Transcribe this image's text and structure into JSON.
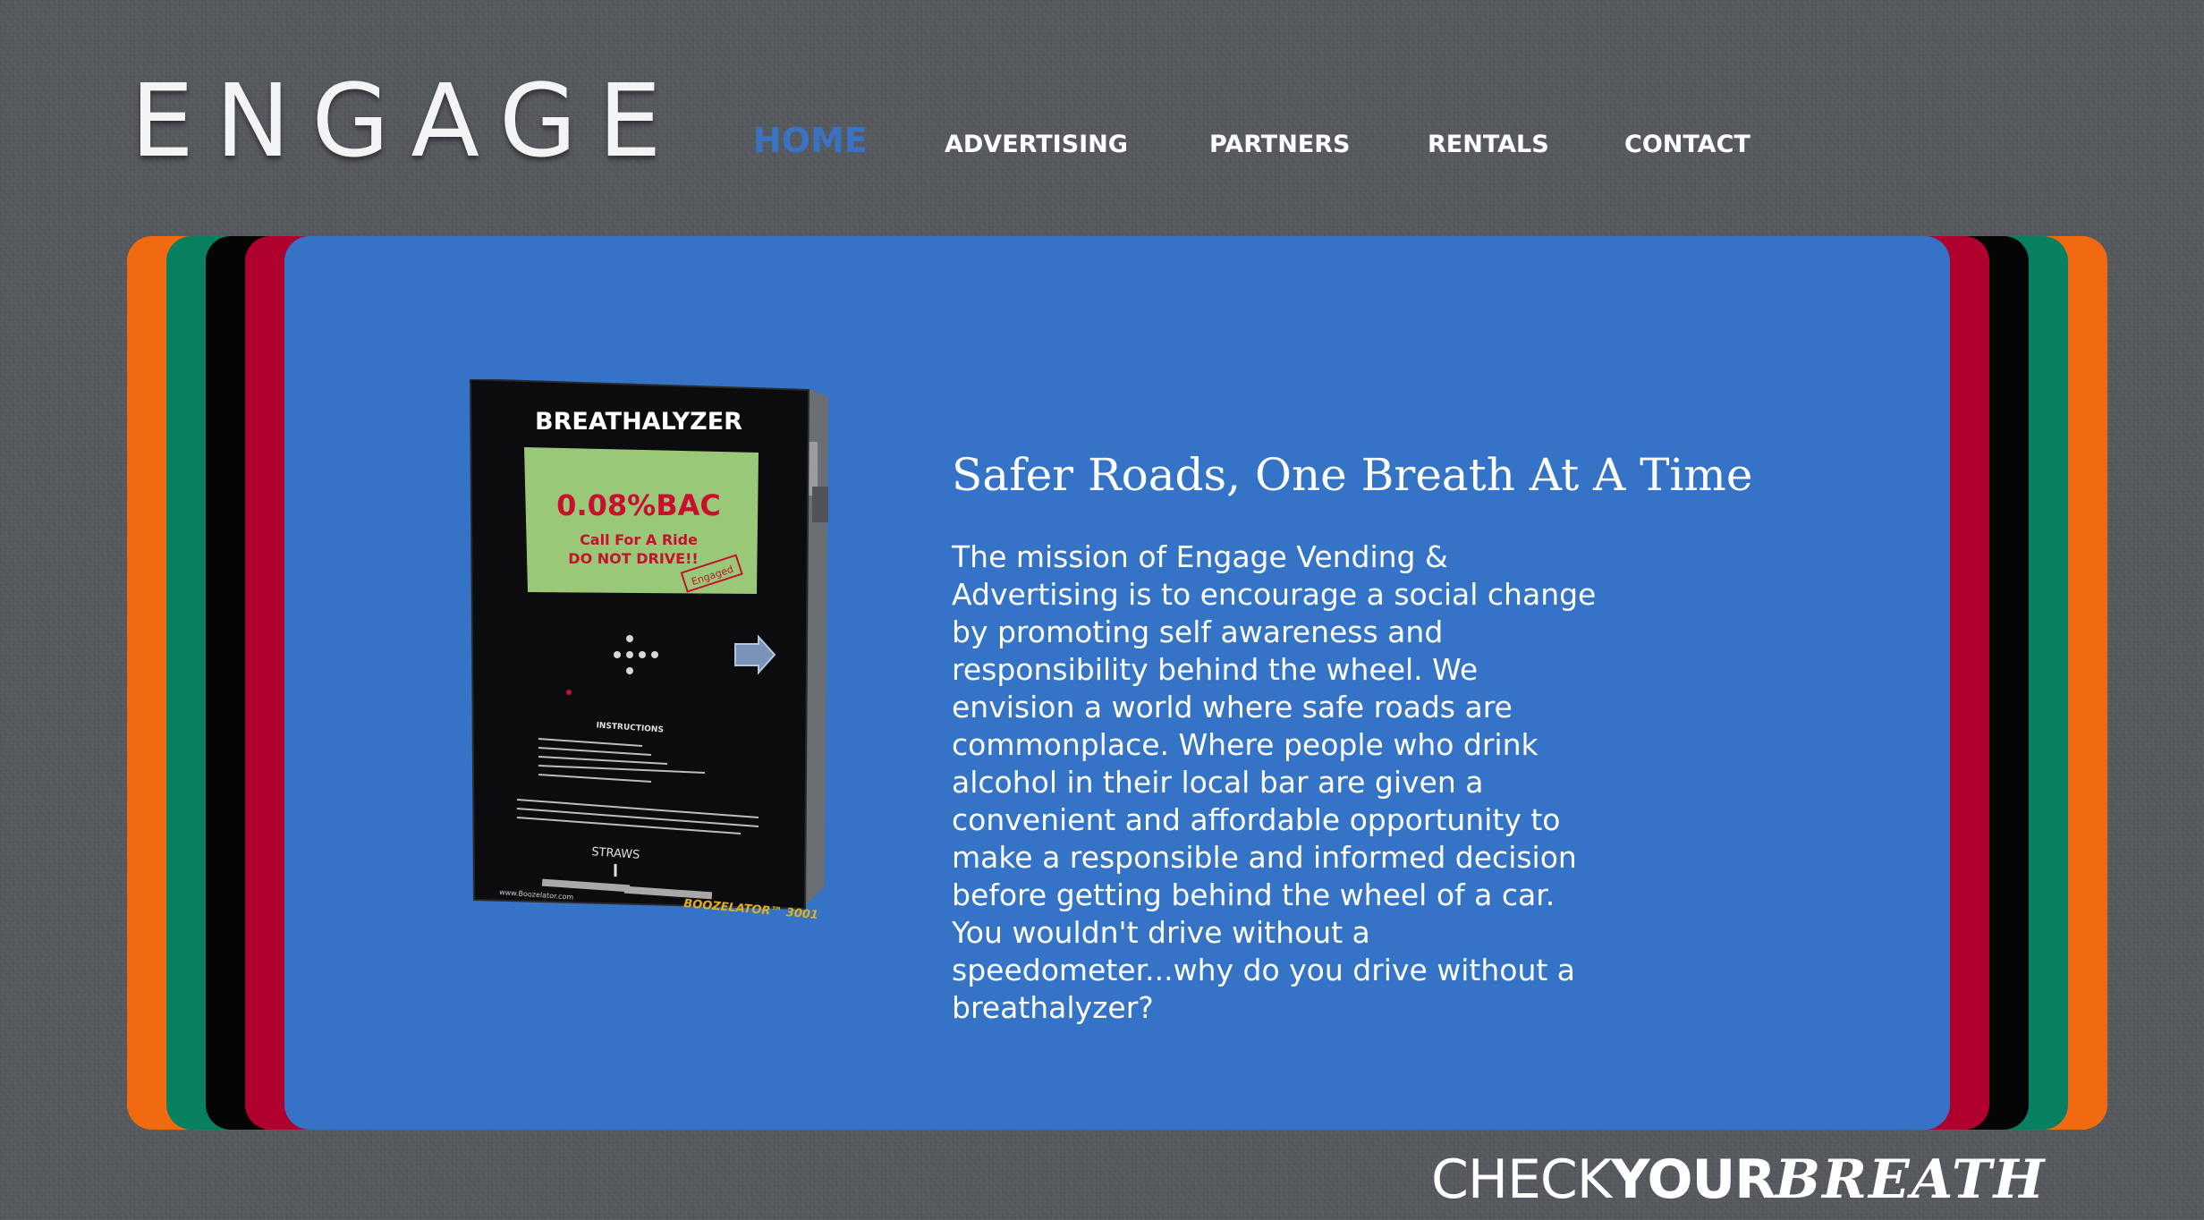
{
  "brand": {
    "logo_text": "ENGAGE"
  },
  "nav": {
    "items": [
      {
        "label": "HOME",
        "active": true
      },
      {
        "label": "ADVERTISING",
        "active": false
      },
      {
        "label": "PARTNERS",
        "active": false
      },
      {
        "label": "RENTALS",
        "active": false
      },
      {
        "label": "CONTACT",
        "active": false
      }
    ]
  },
  "hero": {
    "machine": {
      "title": "BREATHALYZER",
      "reading": "0.08%BAC",
      "line1": "Call For A Ride",
      "line2": "DO NOT DRIVE!!",
      "stamp": "Engaged",
      "instructions_title": "INSTRUCTIONS",
      "straws_label": "STRAWS",
      "model": "BOOZELATOR™ 3001",
      "website": "www.Boozelator.com"
    },
    "headline": "Safer Roads, One Breath At A Time",
    "mission": "The mission of Engage Vending & Advertising is to encourage a social change by promoting self awareness and responsibility behind the wheel. We envision a world where safe roads are commonplace. Where people who drink alcohol in their local bar are given a convenient and affordable opportunity to make a responsible and informed decision before getting behind the wheel of a car. You wouldn't drive without a speedometer...why do you drive without a breathalyzer?"
  },
  "tagline": {
    "part1": "CHECK",
    "part2": "YOUR",
    "part3": "BREATH"
  },
  "colors": {
    "background": "#55585d",
    "panel": "#3473c6",
    "nav_active": "#3a73c4",
    "band_orange": "#f26a10",
    "band_green": "#068060",
    "band_black": "#050505",
    "band_red": "#b0002e",
    "machine_screen": "#98c878",
    "machine_text_red": "#c8102e"
  }
}
